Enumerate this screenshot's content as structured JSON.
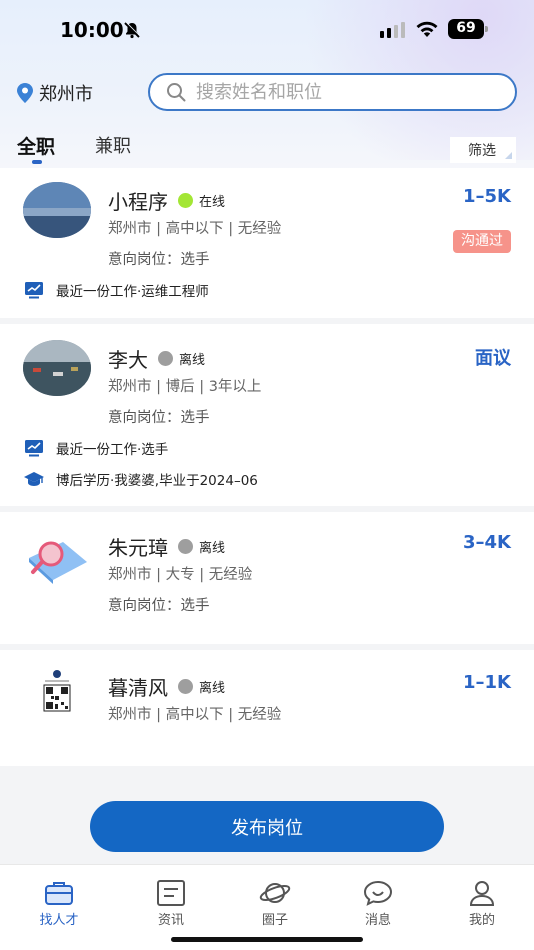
{
  "status_bar": {
    "time": "10:00",
    "battery": "69"
  },
  "header": {
    "city": "郑州市",
    "search_placeholder": "搜索姓名和职位"
  },
  "tabs": [
    {
      "label": "全职",
      "active": true
    },
    {
      "label": "兼职",
      "active": false
    }
  ],
  "filter_label": "筛选",
  "candidates": [
    {
      "name": "小程序",
      "status": "在线",
      "status_color": "#a3e635",
      "salary": "1–5K",
      "meta": "郑州市 | 高中以下 | 无经验",
      "intent": "意向岗位：选手",
      "badge": "沟通过",
      "last_job": "最近一份工作·运维工程师"
    },
    {
      "name": "李大",
      "status": "离线",
      "status_color": "#9e9e9e",
      "salary": "面议",
      "meta": "郑州市 | 博后 | 3年以上",
      "intent": "意向岗位：选手",
      "last_job": "最近一份工作·选手",
      "education": "博后学历·我婆婆,毕业于2024–06"
    },
    {
      "name": "朱元璋",
      "status": "离线",
      "status_color": "#9e9e9e",
      "salary": "3–4K",
      "meta": "郑州市 | 大专 | 无经验",
      "intent": "意向岗位：选手"
    },
    {
      "name": "暮清风",
      "status": "离线",
      "status_color": "#9e9e9e",
      "salary": "1–1K",
      "meta": "郑州市 | 高中以下 | 无经验"
    }
  ],
  "publish_label": "发布岗位",
  "bottom_nav": [
    {
      "label": "找人才",
      "icon": "briefcase-icon",
      "active": true
    },
    {
      "label": "资讯",
      "icon": "news-icon",
      "active": false
    },
    {
      "label": "圈子",
      "icon": "planet-icon",
      "active": false
    },
    {
      "label": "消息",
      "icon": "chat-icon",
      "active": false
    },
    {
      "label": "我的",
      "icon": "user-icon",
      "active": false
    }
  ],
  "colors": {
    "accent": "#2a64c5",
    "button": "#1467c4",
    "badge": "#f6938a"
  }
}
